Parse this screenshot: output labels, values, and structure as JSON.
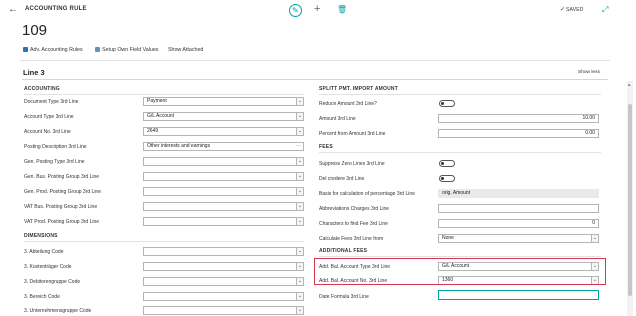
{
  "header": {
    "caption": "ACCOUNTING RULE",
    "title": "109",
    "saved_label": "SAVED"
  },
  "actions": [
    {
      "label": "Adv. Accounting Rules",
      "icon": "accounting-rules-icon",
      "color": "#2e6fb8"
    },
    {
      "label": "Setup Own Field Values",
      "icon": "setup-icon",
      "color": "#6a8fb8"
    },
    {
      "label": "Show Attached",
      "icon": "",
      "color": ""
    }
  ],
  "section": {
    "title": "Line 3",
    "show_less": "Show less"
  },
  "left": {
    "accounting": {
      "header": "ACCOUNTING",
      "fields": [
        {
          "label": "Document Type 3rd Line",
          "value": "Payment"
        },
        {
          "label": "Account Type 3rd Line",
          "value": "G/L Account"
        },
        {
          "label": "Account No. 3rd Line",
          "value": "2649"
        },
        {
          "label": "Posting Description 3rd Line",
          "value": "Other interests and earnings"
        },
        {
          "label": "Gen. Posting Type 3rd Line",
          "value": ""
        },
        {
          "label": "Gen. Bus. Posting Group 3rd Line",
          "value": ""
        },
        {
          "label": "Gen. Prod. Posting Group 3rd Line",
          "value": ""
        },
        {
          "label": "VAT Bus. Posting Group 3rd Line",
          "value": ""
        },
        {
          "label": "VAT Prod. Posting Group 3rd Line",
          "value": ""
        }
      ]
    },
    "dimensions": {
      "header": "DIMENSIONS",
      "fields": [
        {
          "label": "3. Abteilung Code",
          "value": ""
        },
        {
          "label": "3. Kostenträger Code",
          "value": ""
        },
        {
          "label": "3. Debitorengruppe Code",
          "value": ""
        },
        {
          "label": "3. Bereich Code",
          "value": ""
        },
        {
          "label": "3. Unternehmensgruppe Code",
          "value": ""
        }
      ]
    }
  },
  "right": {
    "split": {
      "header": "SPLITT PMT. IMPORT AMOUNT",
      "fields": [
        {
          "label": "Reduce Amount 3rd Line?",
          "value": ""
        },
        {
          "label": "Amount 3rd Line",
          "value": "10.00"
        },
        {
          "label": "Percent from Amount 3rd Line",
          "value": "0.00"
        }
      ]
    },
    "fees": {
      "header": "FEES",
      "fields": [
        {
          "label": "Suppress Zero Lines 3rd Line",
          "value": ""
        },
        {
          "label": "Del credere 3rd Line",
          "value": ""
        },
        {
          "label": "Basis for calculation of percentage 3rd Line",
          "value": "orig. Amount"
        },
        {
          "label": "Abbreviations Charges 3rd Line",
          "value": ""
        },
        {
          "label": "Characters to find Fee 3rd Line",
          "value": "0"
        },
        {
          "label": "Calculate Fees 3rd Line from",
          "value": "None"
        }
      ]
    },
    "additional": {
      "header": "ADDITIONAL FEES",
      "fields": [
        {
          "label": "Add. Bal. Account Type 3rd Line",
          "value": "G/L Account"
        },
        {
          "label": "Add. Bal. Account No. 3rd Line",
          "value": "1360"
        },
        {
          "label": "Date Formula 3rd Line",
          "value": ""
        }
      ]
    }
  },
  "colors": {
    "accent": "#00a4a6",
    "highlight": "#d9364b"
  }
}
